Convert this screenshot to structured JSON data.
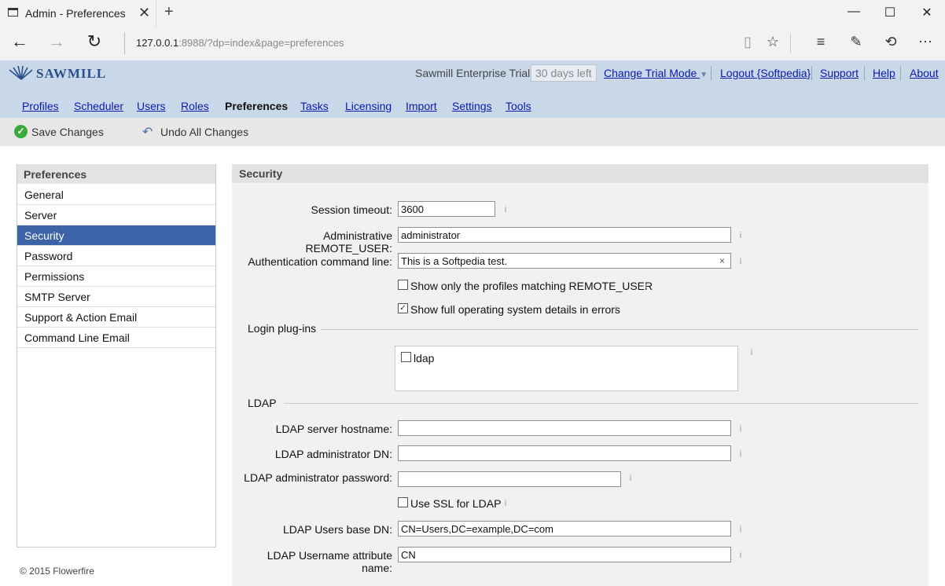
{
  "browser": {
    "tab_title": "Admin - Preferences",
    "url_host": "127.0.0.1",
    "url_rest": ":8988/?dp=index&page=preferences"
  },
  "header": {
    "logo_text": "SAWMILL",
    "trial_name": "Sawmill Enterprise Trial",
    "trial_badge": "30 days left",
    "change_trial": "Change Trial Mode",
    "logout": "Logout {Softpedia}",
    "support": "Support",
    "help": "Help",
    "about": "About"
  },
  "nav": [
    "Profiles",
    "Scheduler",
    "Users",
    "Roles",
    "Preferences",
    "Tasks",
    "Licensing",
    "Import",
    "Settings",
    "Tools"
  ],
  "actions": {
    "save": "Save Changes",
    "undo": "Undo All Changes"
  },
  "sidebar": {
    "title": "Preferences",
    "items": [
      "General",
      "Server",
      "Security",
      "Password",
      "Permissions",
      "SMTP Server",
      "Support & Action Email",
      "Command Line Email"
    ],
    "selected": "Security"
  },
  "footer": "© 2015 Flowerfire",
  "panel": {
    "title": "Security",
    "session_timeout_label": "Session timeout:",
    "session_timeout_value": "3600",
    "remote_user_label": "Administrative REMOTE_USER:",
    "remote_user_value": "administrator",
    "auth_cmd_label": "Authentication command line:",
    "auth_cmd_value": "This is a Softpedia test.",
    "only_profiles_label": "Show only the profiles matching REMOTE_USER",
    "only_profiles_checked": false,
    "full_os_label": "Show full operating system details in errors",
    "full_os_checked": true,
    "login_plugins_title": "Login plug-ins",
    "ldap_plugin_label": "ldap",
    "ldap_plugin_checked": false,
    "ldap_title": "LDAP",
    "ldap_host_label": "LDAP server hostname:",
    "ldap_host_value": "",
    "ldap_admin_dn_label": "LDAP administrator DN:",
    "ldap_admin_dn_value": "",
    "ldap_admin_pw_label": "LDAP administrator password:",
    "ldap_admin_pw_value": "",
    "use_ssl_label": "Use SSL for LDAP",
    "use_ssl_checked": false,
    "users_base_dn_label": "LDAP Users base DN:",
    "users_base_dn_value": "CN=Users,DC=example,DC=com",
    "username_attr_label": "LDAP Username attribute name:",
    "username_attr_value": "CN",
    "info_glyph": "i",
    "clear_glyph": "×"
  }
}
